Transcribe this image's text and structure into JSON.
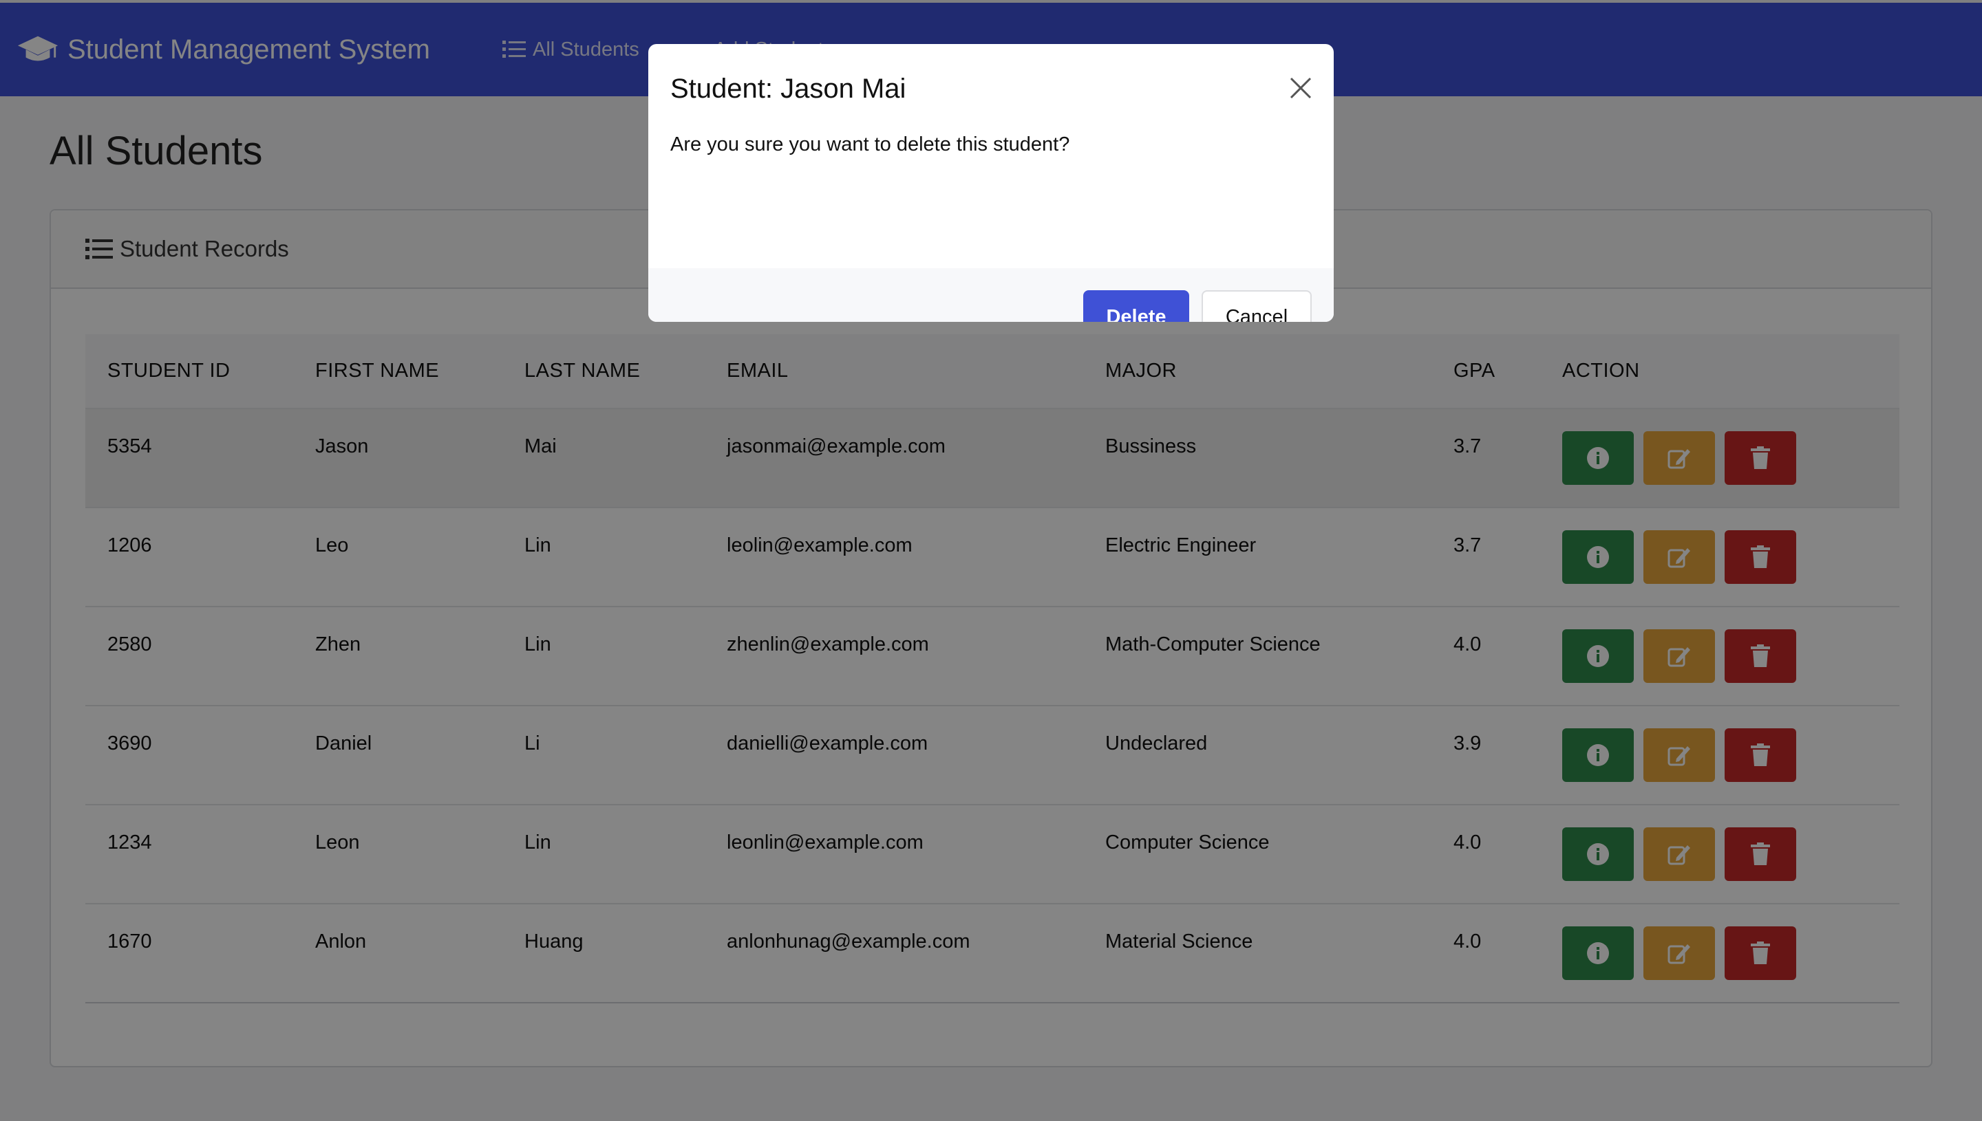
{
  "navbar": {
    "brand": "Student Management System",
    "links": [
      {
        "label": "All Students",
        "icon": "list-icon"
      },
      {
        "label": "Add Student",
        "icon": "plus-icon"
      }
    ],
    "background": "#3f51d6"
  },
  "page": {
    "title": "All Students"
  },
  "card": {
    "header": "Student Records"
  },
  "table": {
    "columns": [
      "STUDENT ID",
      "FIRST NAME",
      "LAST NAME",
      "EMAIL",
      "MAJOR",
      "GPA",
      "ACTION"
    ],
    "rows": [
      {
        "id": "5354",
        "first": "Jason",
        "last": "Mai",
        "email": "jasonmai@example.com",
        "major": "Bussiness",
        "gpa": "3.7"
      },
      {
        "id": "1206",
        "first": "Leo",
        "last": "Lin",
        "email": "leolin@example.com",
        "major": "Electric Engineer",
        "gpa": "3.7"
      },
      {
        "id": "2580",
        "first": "Zhen",
        "last": "Lin",
        "email": "zhenlin@example.com",
        "major": "Math-Computer Science",
        "gpa": "4.0"
      },
      {
        "id": "3690",
        "first": "Daniel",
        "last": "Li",
        "email": "danielli@example.com",
        "major": "Undeclared",
        "gpa": "3.9"
      },
      {
        "id": "1234",
        "first": "Leon",
        "last": "Lin",
        "email": "leonlin@example.com",
        "major": "Computer Science",
        "gpa": "4.0"
      },
      {
        "id": "1670",
        "first": "Anlon",
        "last": "Huang",
        "email": "anlonhunag@example.com",
        "major": "Material Science",
        "gpa": "4.0"
      }
    ],
    "action_icons": [
      "info-icon",
      "edit-icon",
      "trash-icon"
    ],
    "action_colors": {
      "info": "#2e8b4b",
      "edit": "#e6a63d",
      "delete": "#c62a2a"
    }
  },
  "modal": {
    "title": "Student: Jason Mai",
    "message": "Are you sure you want to delete this student?",
    "delete_label": "Delete",
    "cancel_label": "Cancel",
    "delete_color": "#3f51d6"
  }
}
